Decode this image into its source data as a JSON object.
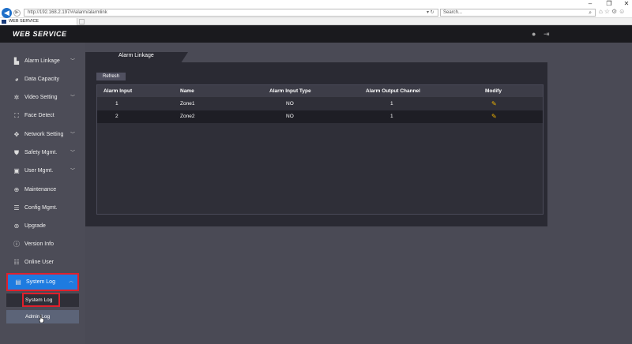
{
  "browser": {
    "url": "http://192.168.2.197/#/alarm/alarmlink",
    "search_placeholder": "Search...",
    "tab_title": "WEB SERVICE"
  },
  "header": {
    "brand": "WEB SERVICE"
  },
  "sidebar": {
    "items": [
      {
        "label": "Alarm Linkage",
        "icon": "alarm-linkage-icon",
        "expandable": true
      },
      {
        "label": "Data Capacity",
        "icon": "pie-chart-icon",
        "expandable": false
      },
      {
        "label": "Video Setting",
        "icon": "video-setting-icon",
        "expandable": true
      },
      {
        "label": "Face Detect",
        "icon": "face-detect-icon",
        "expandable": false
      },
      {
        "label": "Network Setting",
        "icon": "network-icon",
        "expandable": true
      },
      {
        "label": "Safety Mgmt.",
        "icon": "shield-icon",
        "expandable": true
      },
      {
        "label": "User Mgmt.",
        "icon": "user-icon",
        "expandable": true
      },
      {
        "label": "Maintenance",
        "icon": "maintenance-icon",
        "expandable": false
      },
      {
        "label": "Config Mgmt.",
        "icon": "config-icon",
        "expandable": false
      },
      {
        "label": "Upgrade",
        "icon": "upgrade-icon",
        "expandable": false
      },
      {
        "label": "Version Info",
        "icon": "info-icon",
        "expandable": false
      },
      {
        "label": "Online User",
        "icon": "online-user-icon",
        "expandable": false
      },
      {
        "label": "System Log",
        "icon": "system-log-icon",
        "expandable": true
      }
    ],
    "sub_items": [
      {
        "label": "System Log"
      },
      {
        "label": "Admin Log"
      }
    ]
  },
  "main": {
    "tab_label": "Alarm Linkage",
    "refresh_label": "Refresh",
    "columns": [
      "Alarm Input",
      "Name",
      "Alarm Input Type",
      "Alarm Output Channel",
      "Modify"
    ],
    "rows": [
      {
        "alarm_input": "1",
        "name": "Zone1",
        "type": "NO",
        "output": "1"
      },
      {
        "alarm_input": "2",
        "name": "Zone2",
        "type": "NO",
        "output": "1"
      }
    ]
  }
}
